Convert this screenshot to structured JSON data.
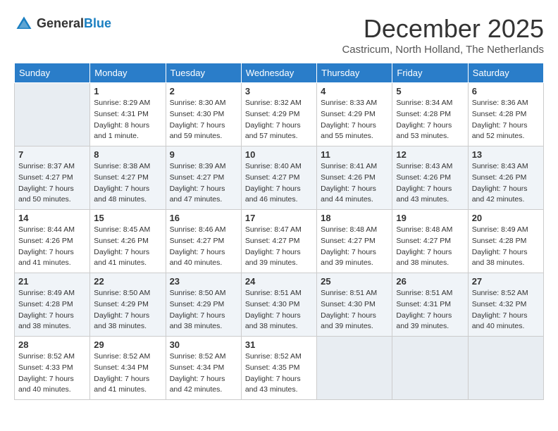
{
  "header": {
    "logo_general": "General",
    "logo_blue": "Blue",
    "month": "December 2025",
    "location": "Castricum, North Holland, The Netherlands"
  },
  "weekdays": [
    "Sunday",
    "Monday",
    "Tuesday",
    "Wednesday",
    "Thursday",
    "Friday",
    "Saturday"
  ],
  "weeks": [
    [
      {
        "day": "",
        "info": ""
      },
      {
        "day": "1",
        "info": "Sunrise: 8:29 AM\nSunset: 4:31 PM\nDaylight: 8 hours\nand 1 minute."
      },
      {
        "day": "2",
        "info": "Sunrise: 8:30 AM\nSunset: 4:30 PM\nDaylight: 7 hours\nand 59 minutes."
      },
      {
        "day": "3",
        "info": "Sunrise: 8:32 AM\nSunset: 4:29 PM\nDaylight: 7 hours\nand 57 minutes."
      },
      {
        "day": "4",
        "info": "Sunrise: 8:33 AM\nSunset: 4:29 PM\nDaylight: 7 hours\nand 55 minutes."
      },
      {
        "day": "5",
        "info": "Sunrise: 8:34 AM\nSunset: 4:28 PM\nDaylight: 7 hours\nand 53 minutes."
      },
      {
        "day": "6",
        "info": "Sunrise: 8:36 AM\nSunset: 4:28 PM\nDaylight: 7 hours\nand 52 minutes."
      }
    ],
    [
      {
        "day": "7",
        "info": "Sunrise: 8:37 AM\nSunset: 4:27 PM\nDaylight: 7 hours\nand 50 minutes."
      },
      {
        "day": "8",
        "info": "Sunrise: 8:38 AM\nSunset: 4:27 PM\nDaylight: 7 hours\nand 48 minutes."
      },
      {
        "day": "9",
        "info": "Sunrise: 8:39 AM\nSunset: 4:27 PM\nDaylight: 7 hours\nand 47 minutes."
      },
      {
        "day": "10",
        "info": "Sunrise: 8:40 AM\nSunset: 4:27 PM\nDaylight: 7 hours\nand 46 minutes."
      },
      {
        "day": "11",
        "info": "Sunrise: 8:41 AM\nSunset: 4:26 PM\nDaylight: 7 hours\nand 44 minutes."
      },
      {
        "day": "12",
        "info": "Sunrise: 8:43 AM\nSunset: 4:26 PM\nDaylight: 7 hours\nand 43 minutes."
      },
      {
        "day": "13",
        "info": "Sunrise: 8:43 AM\nSunset: 4:26 PM\nDaylight: 7 hours\nand 42 minutes."
      }
    ],
    [
      {
        "day": "14",
        "info": "Sunrise: 8:44 AM\nSunset: 4:26 PM\nDaylight: 7 hours\nand 41 minutes."
      },
      {
        "day": "15",
        "info": "Sunrise: 8:45 AM\nSunset: 4:26 PM\nDaylight: 7 hours\nand 41 minutes."
      },
      {
        "day": "16",
        "info": "Sunrise: 8:46 AM\nSunset: 4:27 PM\nDaylight: 7 hours\nand 40 minutes."
      },
      {
        "day": "17",
        "info": "Sunrise: 8:47 AM\nSunset: 4:27 PM\nDaylight: 7 hours\nand 39 minutes."
      },
      {
        "day": "18",
        "info": "Sunrise: 8:48 AM\nSunset: 4:27 PM\nDaylight: 7 hours\nand 39 minutes."
      },
      {
        "day": "19",
        "info": "Sunrise: 8:48 AM\nSunset: 4:27 PM\nDaylight: 7 hours\nand 38 minutes."
      },
      {
        "day": "20",
        "info": "Sunrise: 8:49 AM\nSunset: 4:28 PM\nDaylight: 7 hours\nand 38 minutes."
      }
    ],
    [
      {
        "day": "21",
        "info": "Sunrise: 8:49 AM\nSunset: 4:28 PM\nDaylight: 7 hours\nand 38 minutes."
      },
      {
        "day": "22",
        "info": "Sunrise: 8:50 AM\nSunset: 4:29 PM\nDaylight: 7 hours\nand 38 minutes."
      },
      {
        "day": "23",
        "info": "Sunrise: 8:50 AM\nSunset: 4:29 PM\nDaylight: 7 hours\nand 38 minutes."
      },
      {
        "day": "24",
        "info": "Sunrise: 8:51 AM\nSunset: 4:30 PM\nDaylight: 7 hours\nand 38 minutes."
      },
      {
        "day": "25",
        "info": "Sunrise: 8:51 AM\nSunset: 4:30 PM\nDaylight: 7 hours\nand 39 minutes."
      },
      {
        "day": "26",
        "info": "Sunrise: 8:51 AM\nSunset: 4:31 PM\nDaylight: 7 hours\nand 39 minutes."
      },
      {
        "day": "27",
        "info": "Sunrise: 8:52 AM\nSunset: 4:32 PM\nDaylight: 7 hours\nand 40 minutes."
      }
    ],
    [
      {
        "day": "28",
        "info": "Sunrise: 8:52 AM\nSunset: 4:33 PM\nDaylight: 7 hours\nand 40 minutes."
      },
      {
        "day": "29",
        "info": "Sunrise: 8:52 AM\nSunset: 4:34 PM\nDaylight: 7 hours\nand 41 minutes."
      },
      {
        "day": "30",
        "info": "Sunrise: 8:52 AM\nSunset: 4:34 PM\nDaylight: 7 hours\nand 42 minutes."
      },
      {
        "day": "31",
        "info": "Sunrise: 8:52 AM\nSunset: 4:35 PM\nDaylight: 7 hours\nand 43 minutes."
      },
      {
        "day": "",
        "info": ""
      },
      {
        "day": "",
        "info": ""
      },
      {
        "day": "",
        "info": ""
      }
    ]
  ]
}
